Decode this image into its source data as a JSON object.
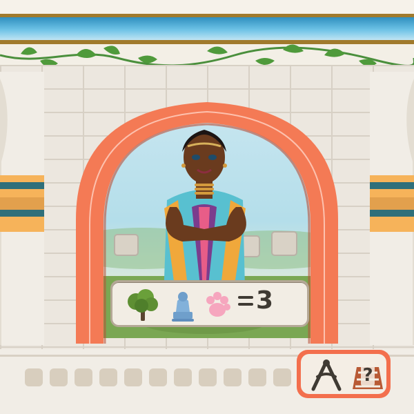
{
  "card": {
    "formula": {
      "equals_icon": "equals-icon",
      "value": "3"
    },
    "icons": {
      "tree": "tree-icon",
      "statue": "statue-icon",
      "paw": "paw-icon",
      "compass": "compass-icon",
      "question": "question-icon"
    },
    "colors": {
      "arch": "#f47a55",
      "formula_border": "#b4a896",
      "tree": "#5e8f33",
      "statue": "#6f9fcb",
      "paw": "#f6a6be",
      "action_border": "#f36f4d",
      "sky": "#4fb0dc"
    }
  }
}
